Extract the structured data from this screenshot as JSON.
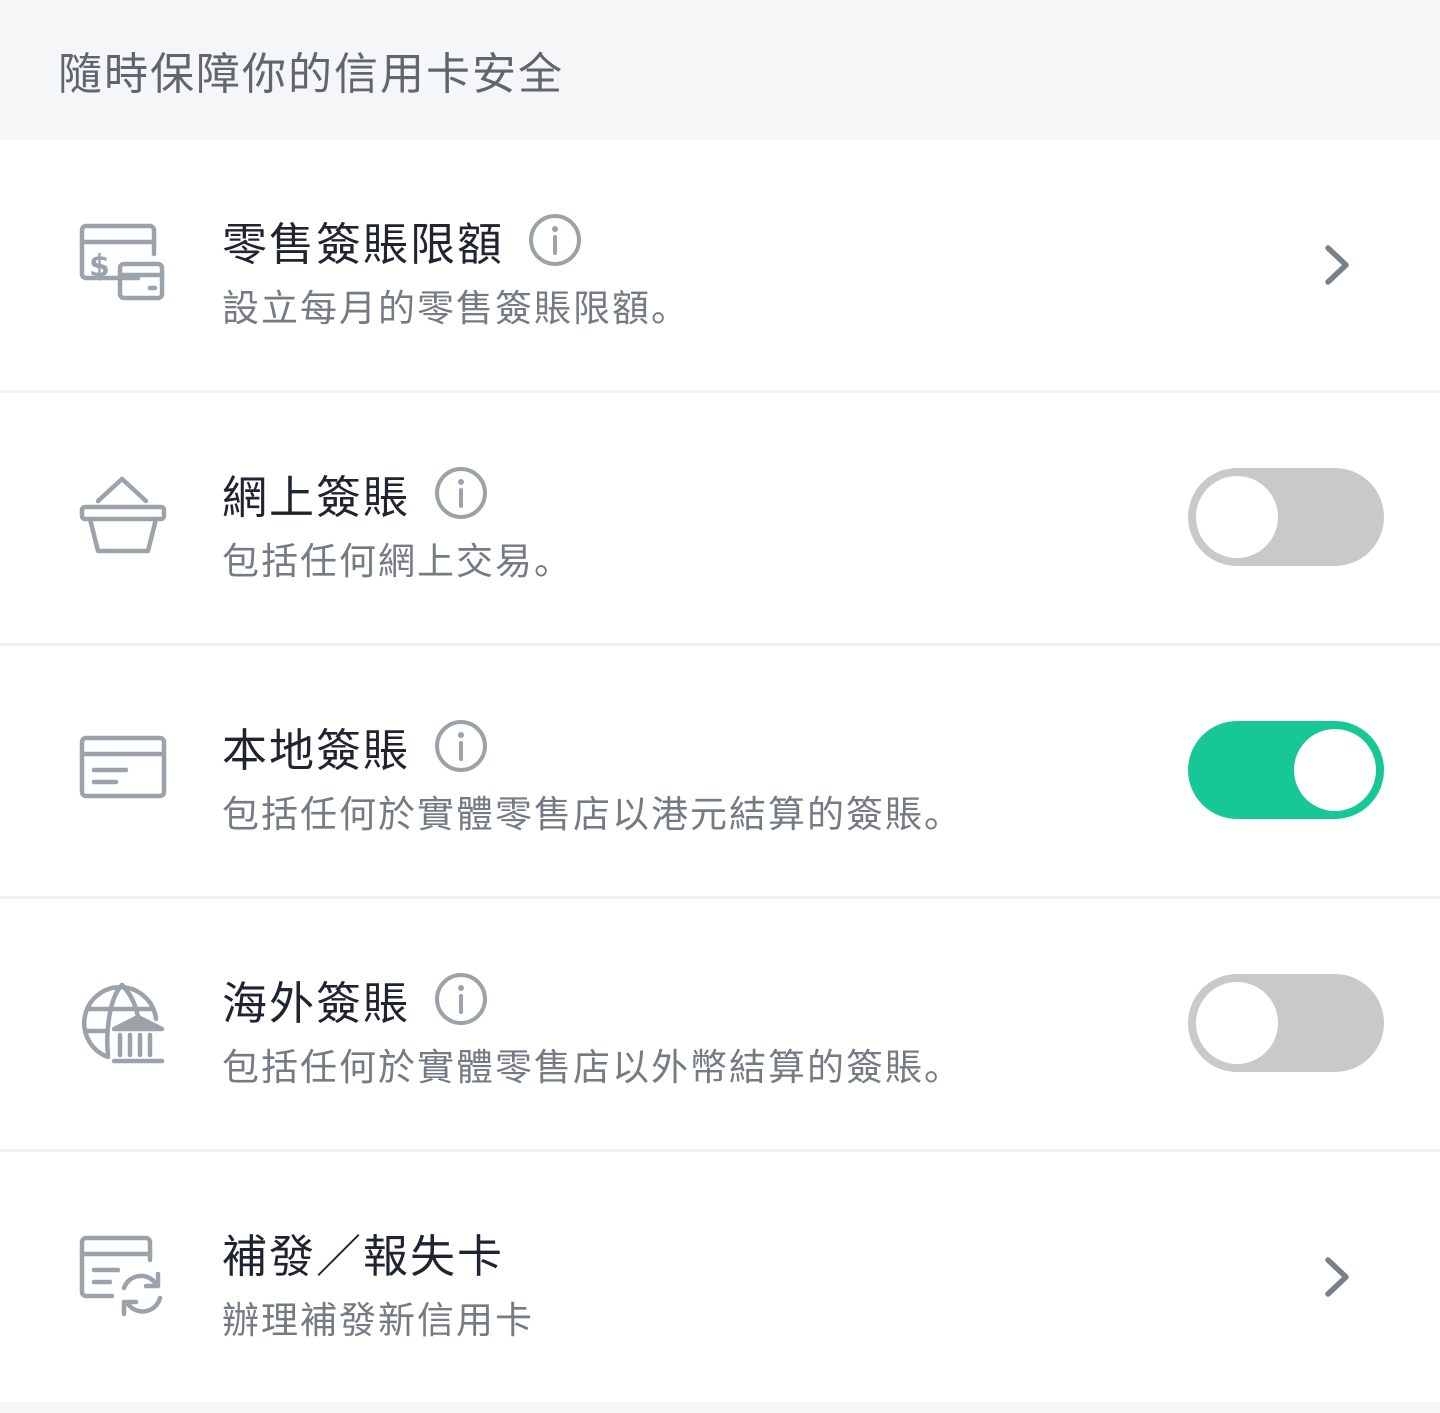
{
  "header": {
    "title": "隨時保障你的信用卡安全"
  },
  "rows": [
    {
      "title": "零售簽賬限額",
      "subtitle": "設立每月的零售簽賬限額。",
      "icon": "retail-limit-icon",
      "has_info": true,
      "control": "chevron"
    },
    {
      "title": "網上簽賬",
      "subtitle": "包括任何網上交易。",
      "icon": "shopping-basket-icon",
      "has_info": true,
      "control": "toggle",
      "toggle_on": false
    },
    {
      "title": "本地簽賬",
      "subtitle": "包括任何於實體零售店以港元結算的簽賬。",
      "icon": "card-icon",
      "has_info": true,
      "control": "toggle",
      "toggle_on": true
    },
    {
      "title": "海外簽賬",
      "subtitle": "包括任何於實體零售店以外幣結算的簽賬。",
      "icon": "globe-bank-icon",
      "has_info": true,
      "control": "toggle",
      "toggle_on": false
    },
    {
      "title": "補發／報失卡",
      "subtitle": "辦理補發新信用卡",
      "icon": "card-replace-icon",
      "has_info": false,
      "control": "chevron"
    }
  ],
  "colors": {
    "toggle_on": "#17c795",
    "toggle_off": "#c9c9c9",
    "icon_gray": "#9ca2aa",
    "title_text": "#1f2430",
    "subtitle_text": "#757b84",
    "page_bg": "#f5f6f8"
  }
}
